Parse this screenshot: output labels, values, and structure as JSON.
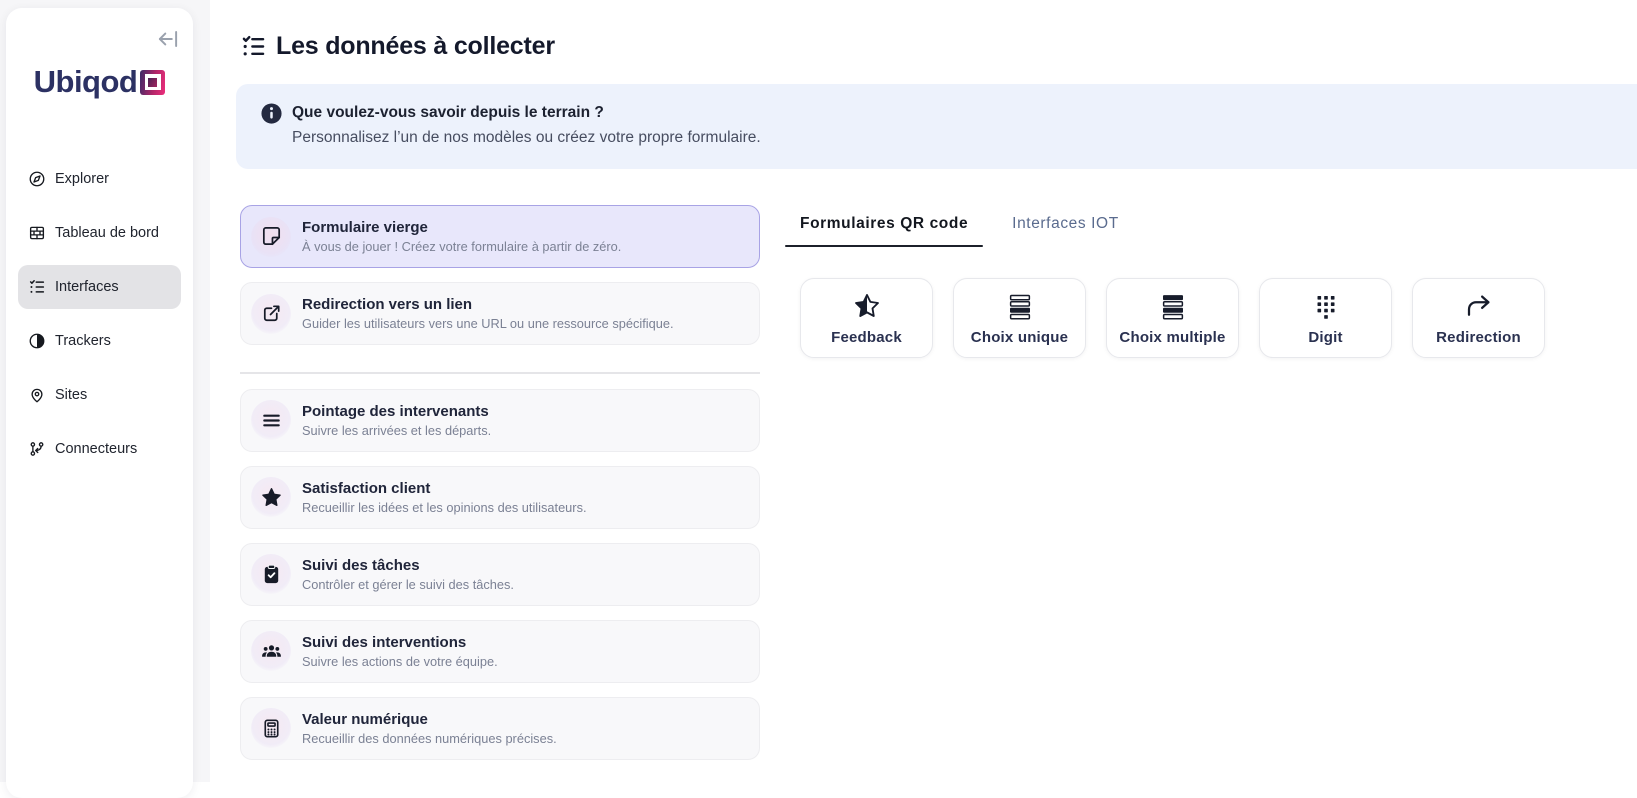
{
  "sidebar": {
    "logo_text": "Ubiqod",
    "collapse_icon": "collapse-left",
    "items": [
      {
        "label": "Explorer",
        "icon": "compass",
        "active": false
      },
      {
        "label": "Tableau de bord",
        "icon": "wall",
        "active": false
      },
      {
        "label": "Interfaces",
        "icon": "list-check",
        "active": true
      },
      {
        "label": "Trackers",
        "icon": "contrast",
        "active": false
      },
      {
        "label": "Sites",
        "icon": "map-pin",
        "active": false
      },
      {
        "label": "Connecteurs",
        "icon": "git-branch",
        "active": false
      }
    ]
  },
  "header": {
    "icon": "list-check",
    "title": "Les données à collecter"
  },
  "banner": {
    "icon": "info-circle",
    "title": "Que voulez-vous savoir depuis le terrain ?",
    "subtitle": "Personnalisez l’un de nos modèles ou créez votre propre formulaire."
  },
  "templates": [
    {
      "title": "Formulaire vierge",
      "subtitle": "À vous de jouer ! Créez votre formulaire à partir de zéro.",
      "icon": "note",
      "selected": true
    },
    {
      "title": "Redirection vers un lien",
      "subtitle": "Guider les utilisateurs vers une URL ou une ressource spécifique.",
      "icon": "external-link",
      "selected": false
    },
    {
      "title": "Pointage des intervenants",
      "subtitle": "Suivre les arrivées et les départs.",
      "icon": "menu-lines",
      "selected": false
    },
    {
      "title": "Satisfaction client",
      "subtitle": "Recueillir les idées et les opinions des utilisateurs.",
      "icon": "star",
      "selected": false
    },
    {
      "title": "Suivi des tâches",
      "subtitle": "Contrôler et gérer le suivi des tâches.",
      "icon": "clipboard-check",
      "selected": false
    },
    {
      "title": "Suivi des interventions",
      "subtitle": "Suivre les actions de votre équipe.",
      "icon": "users",
      "selected": false
    },
    {
      "title": "Valeur numérique",
      "subtitle": "Recueillir des données numériques précises.",
      "icon": "calculator",
      "selected": false
    }
  ],
  "tabs": [
    {
      "label": "Formulaires QR code",
      "active": true
    },
    {
      "label": "Interfaces IOT",
      "active": false
    }
  ],
  "qr_cards": [
    {
      "label": "Feedback",
      "icon": "star-half"
    },
    {
      "label": "Choix unique",
      "icon": "rows-one-filled"
    },
    {
      "label": "Choix multiple",
      "icon": "rows-two-filled"
    },
    {
      "label": "Digit",
      "icon": "dialpad"
    },
    {
      "label": "Redirection",
      "icon": "arrow-forward"
    }
  ],
  "colors": {
    "selected_card_bg": "#e8e7fb",
    "selected_card_border": "#a8a3e5",
    "banner_bg": "#edf2fc",
    "active_nav_bg": "#e3e3e6",
    "logo_navy": "#2c3163",
    "logo_pink": "#ed2e7b",
    "rail_bg": "#f6f6f8"
  }
}
